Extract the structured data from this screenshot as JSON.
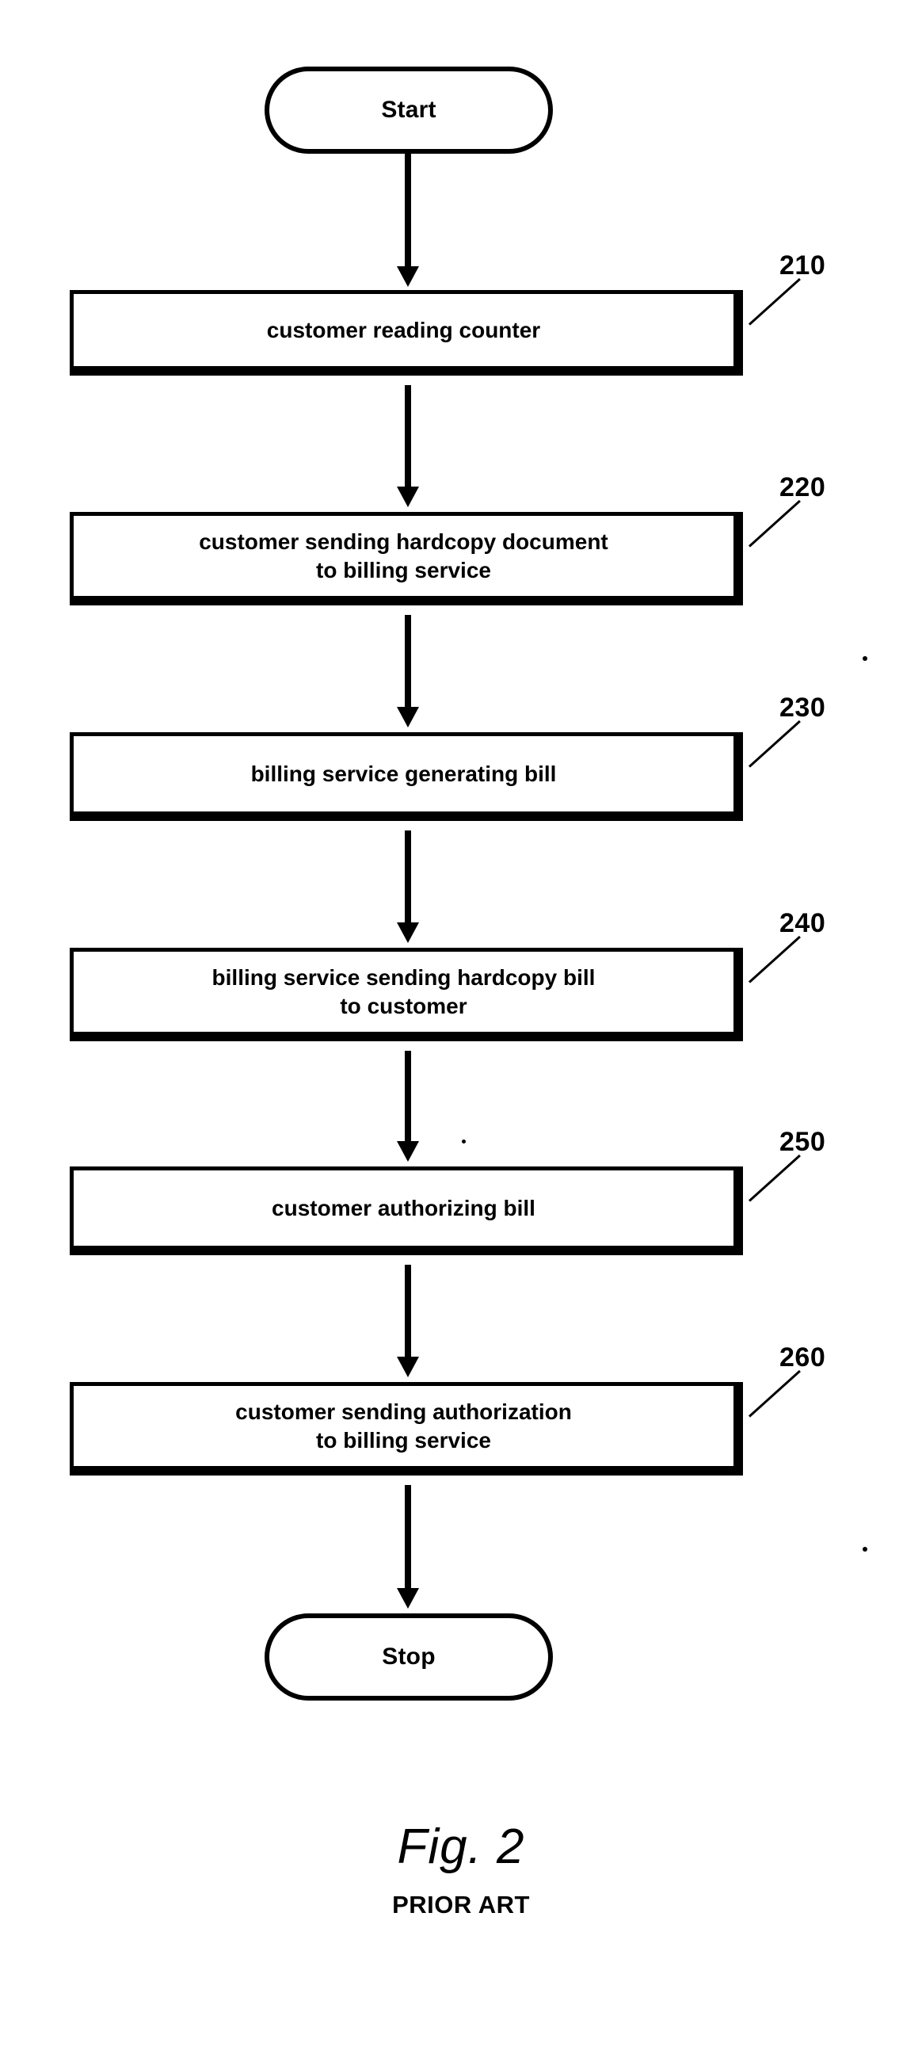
{
  "figure": {
    "caption_title": "Fig. 2",
    "caption_subtitle": "PRIOR ART"
  },
  "flowchart": {
    "type": "flowchart",
    "orientation": "vertical",
    "start_node": {
      "id": "start",
      "shape": "terminator",
      "label": "Start"
    },
    "end_node": {
      "id": "stop",
      "shape": "terminator",
      "label": "Stop"
    },
    "steps": [
      {
        "ref": "210",
        "shape": "process",
        "label": "customer reading counter",
        "lines": [
          "customer reading counter"
        ]
      },
      {
        "ref": "220",
        "shape": "process",
        "label": "customer sending hardcopy document\nto billing service",
        "lines": [
          "customer sending hardcopy document",
          "to billing service"
        ]
      },
      {
        "ref": "230",
        "shape": "process",
        "label": "billing service generating bill",
        "lines": [
          "billing service generating bill"
        ]
      },
      {
        "ref": "240",
        "shape": "process",
        "label": "billing service sending hardcopy bill\nto customer",
        "lines": [
          "billing service sending hardcopy bill",
          "to customer"
        ]
      },
      {
        "ref": "250",
        "shape": "process",
        "label": "customer authorizing bill",
        "lines": [
          "customer authorizing bill"
        ]
      },
      {
        "ref": "260",
        "shape": "process",
        "label": "customer sending authorization\nto billing service",
        "lines": [
          "customer sending authorization",
          "to billing service"
        ]
      }
    ],
    "connectors": [
      {
        "from": "start",
        "to": "210",
        "arrow": "down"
      },
      {
        "from": "210",
        "to": "220",
        "arrow": "down"
      },
      {
        "from": "220",
        "to": "230",
        "arrow": "down"
      },
      {
        "from": "230",
        "to": "240",
        "arrow": "down"
      },
      {
        "from": "240",
        "to": "250",
        "arrow": "down"
      },
      {
        "from": "250",
        "to": "260",
        "arrow": "down"
      },
      {
        "from": "260",
        "to": "stop",
        "arrow": "down"
      }
    ]
  },
  "colors": {
    "ink": "#000000",
    "page": "#ffffff"
  }
}
